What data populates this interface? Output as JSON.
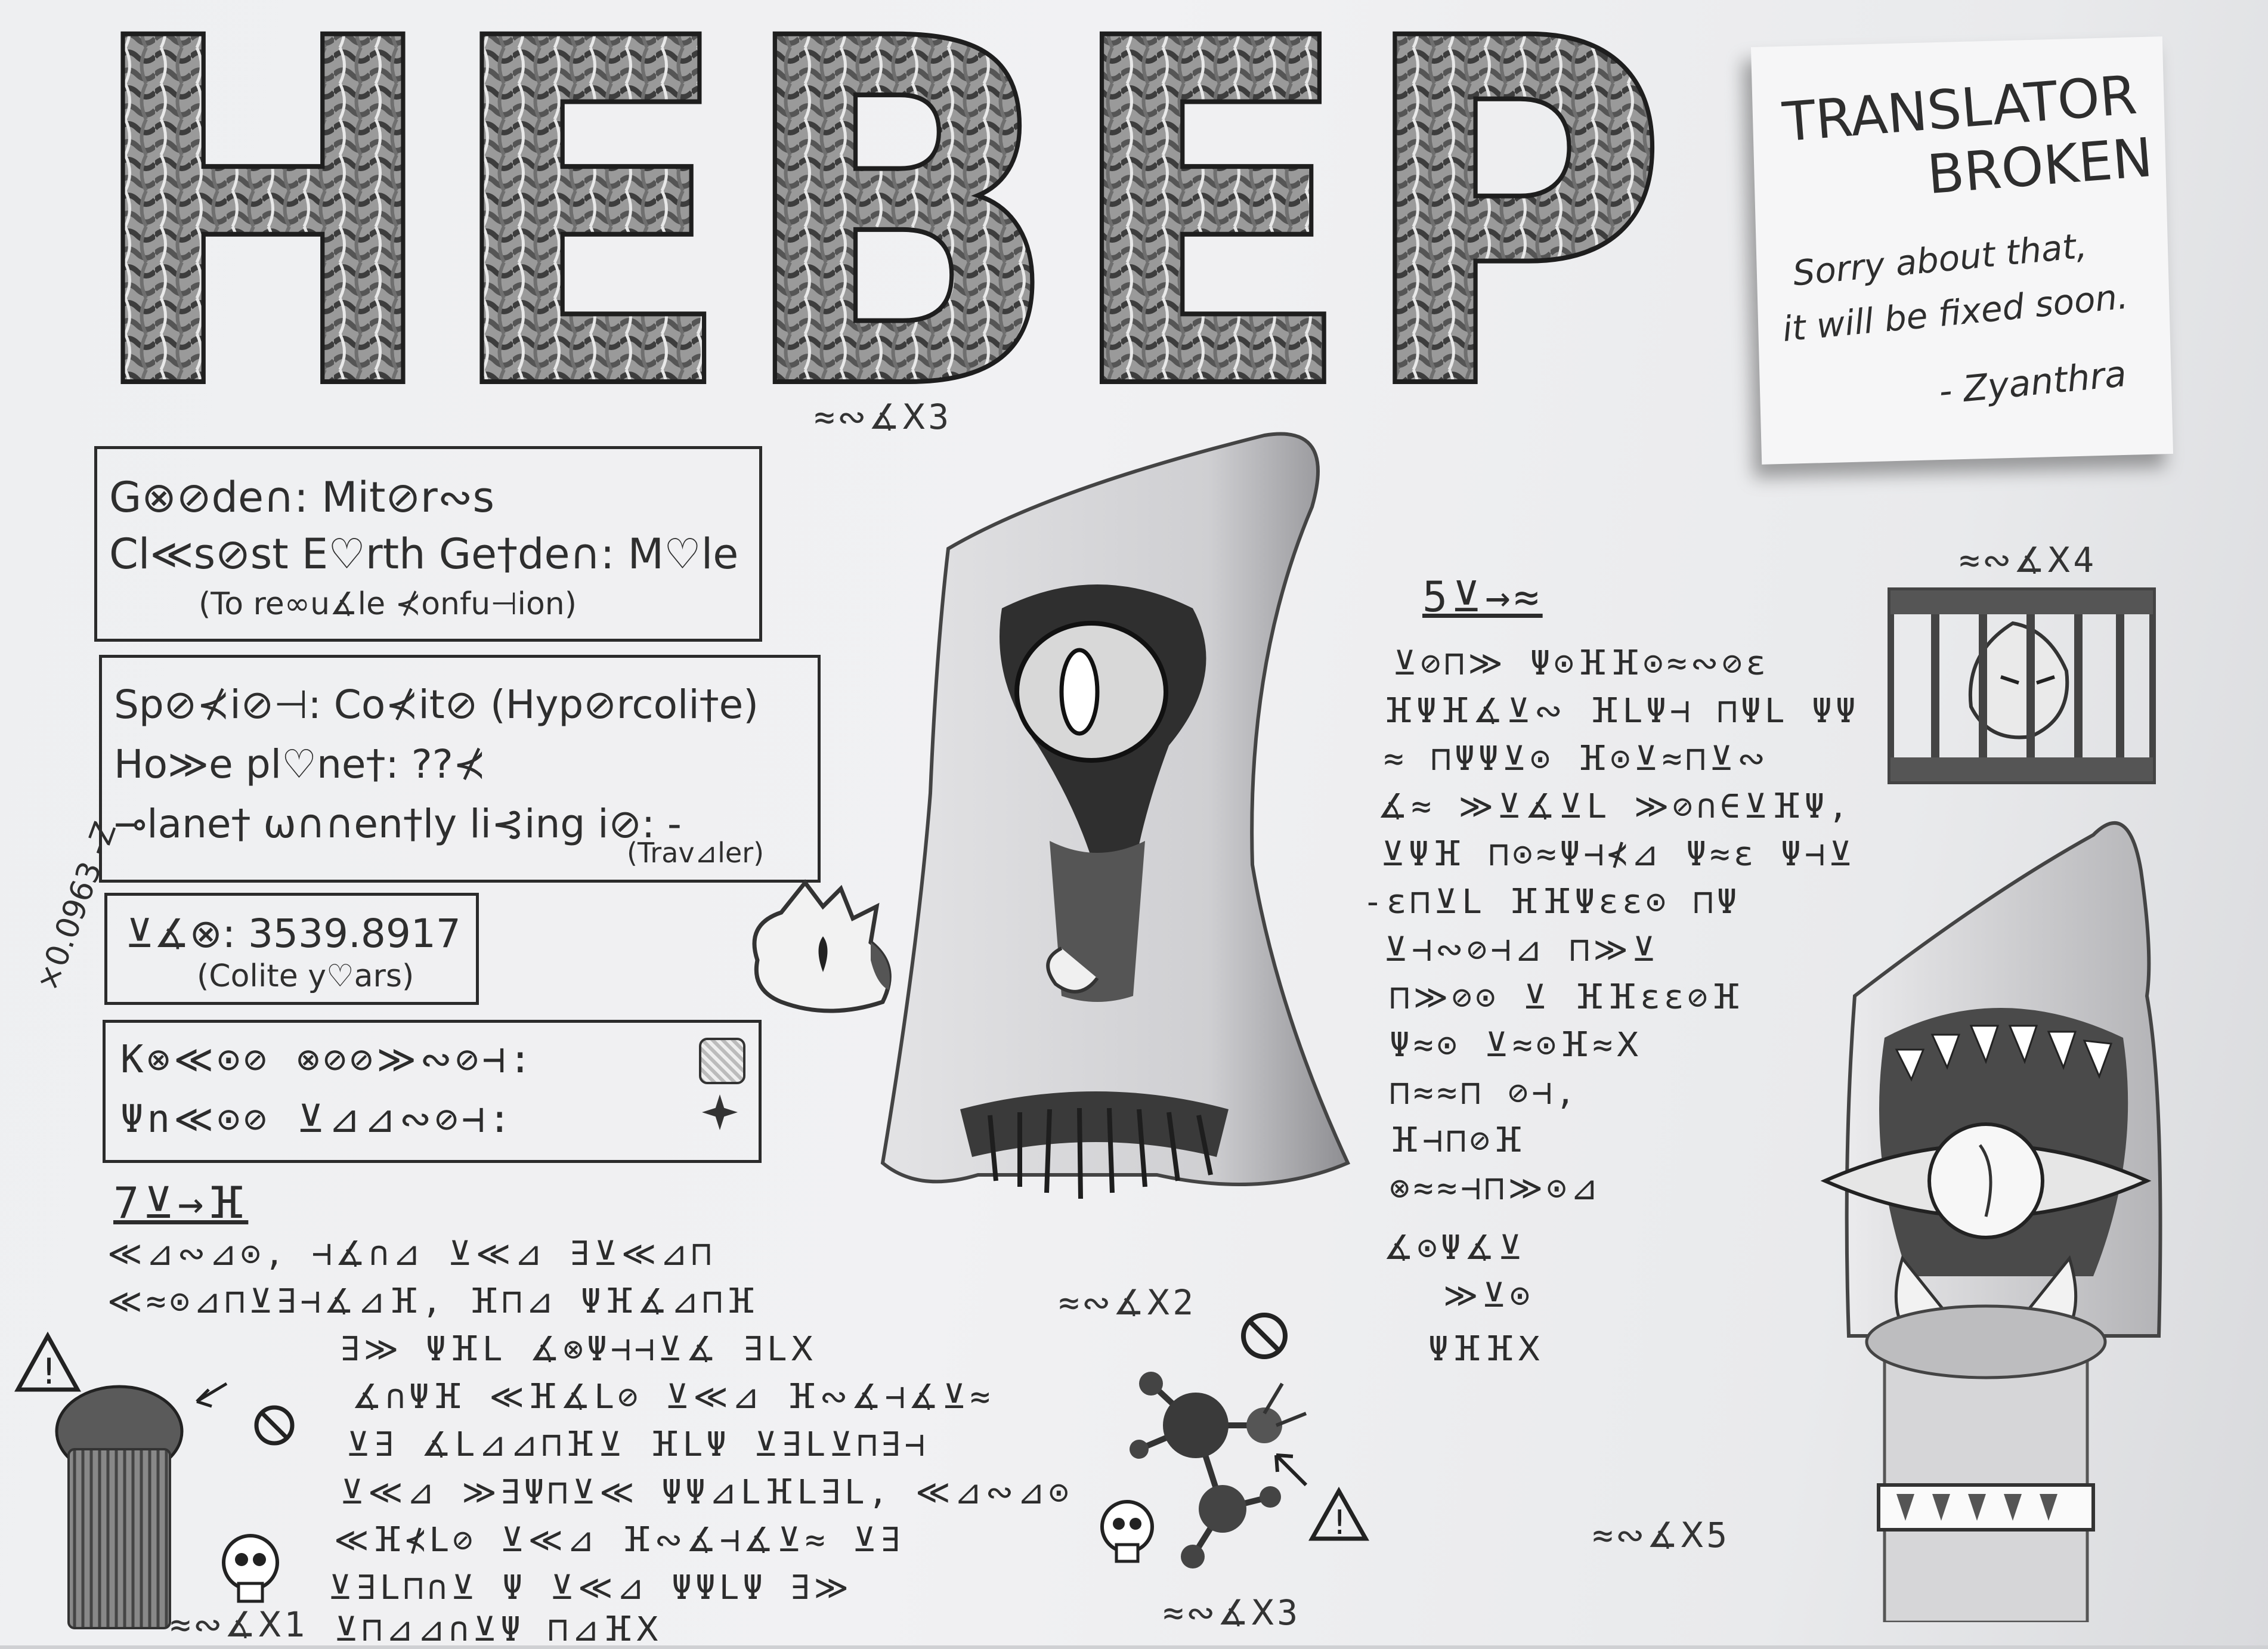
{
  "title": "HEBEP",
  "note": {
    "heading_line1": "TRANSLATOR",
    "heading_line2": "BROKEN",
    "body_line1": "Sorry about that,",
    "body_line2": "it will be fixed soon.",
    "signature": "- Zyanthra"
  },
  "info": {
    "gender": "G⊗⊘de∩: Mit⊘r∾s",
    "earth_gender": "Cl≪s⊘st E♡rth Ge†de∩: M♡le",
    "confusion_note": "(To re∞u∡le ⊀onfu⊣ion)",
    "species": "Sp⊘⊀i⊘⊣: Co⊀it⊘ (Hyp⊘rcoli†e)",
    "home_planet": "Ho≫e pl♡ne†: ??⊀",
    "current_planet": "⊸lane† ω∩∩en†ly li⊰ing i⊘: -",
    "traveler": "(Trav⊿ler)",
    "margin_number": "×0.0963 -Z",
    "age": "⊻∡⊗: 3539.8917",
    "age_units": "(Colite y♡ars)",
    "colors_line1": "K⊗≪⊙⊘ ⊗⊘⊘≫∾⊘⊣:",
    "colors_line2": "Ψn≪⊙⊘ ⊻⊿⊿∾⊘⊣:"
  },
  "sections": {
    "left_heading": "7⊻→ⴼ",
    "right_heading": "5⊻→≈"
  },
  "captions": {
    "fig1": "≈∾∡Ⅹ1",
    "fig2": "≈∾∡Ⅹ2",
    "fig3_top": "≈∾∡Ⅹ3",
    "fig3_bottom": "≈∾∡Ⅹ3",
    "fig4": "≈∾∡Ⅹ4",
    "fig5": "≈∾∡Ⅹ5"
  },
  "glyph_text": {
    "left": [
      "≪⊿∾⊿⊙, ⊣∡∩⊿ ⊻≪⊿ ∃⊻≪⊿⊓",
      "≪≈⊙⊿⊓⊻∃⊣∡⊿ⴼ, ⴼ⊓⊿ Ψⴼ∡⊿⊓ⴼ",
      "∃≫ ΨⴼL ∡⊗Ψ⊣⊣⊻∡ ∃LⅩ",
      "∡∩Ψⴼ ≪ⴼ∡L⊘ ⊻≪⊿ ⴼ∾∡⊣∡⊻≈",
      "⊻∃ ∡L⊿⊿⊓ⴼ⊻ ⴼLΨ ⊻∃L⊻⊓∃⊣",
      "⊻≪⊿ ≫∃Ψ⊓⊻≪ ΨΨ⊿LⴼL∃L, ≪⊿∾⊿⊙",
      "≪ⴼ⊀L⊘ ⊻≪⊿ ⴼ∾∡⊣∡⊻≈ ⊻∃",
      "⊻∃L⊓∩⊻ Ψ ⊻≪⊿ ΨΨLΨ ∃≫",
      "⊻⊓⊿⊿∩⊻Ψ ⊓⊿ⴼⅩ"
    ],
    "right": [
      "⊻⊘⊓≫ Ψ⊙ⴼⴼ⊙≈∾⊘ε",
      "ⴼΨⴼ∡⊻∾ ⴼLΨ⊣ ⊓ΨL ΨΨ",
      "≈ ⊓ΨΨ⊻⊙ ⴼ⊙⊻≈⊓⊻∾",
      "∡≈ ≫⊻∡⊻L ≫⊘∩∈⊻ⴼΨ,",
      "⊻Ψⴼ ⊓⊙≈Ψ⊣⊀⊿ Ψ≈ε Ψ⊣⊻",
      "-ε⊓⊻L ⴼⴼΨεε⊙ ⊓Ψ",
      "⊻⊣∾⊘⊣⊿ ⊓≫⊻",
      "⊓≫⊘⊙ ⊻ ⴼⴼεε⊘ⴼ",
      "Ψ≈⊙ ⊻≈⊙ⴼ≈Ⅹ",
      "⊓≈≈⊓ ⊘⊣,",
      "ⴼ⊣⊓⊘ⴼ",
      "⊗≈≈⊣⊓≫⊙⊿",
      "∡⊙Ψ∡⊻",
      "≫⊻⊙",
      "ΨⴼⴼⅩ",
      ""
    ]
  }
}
